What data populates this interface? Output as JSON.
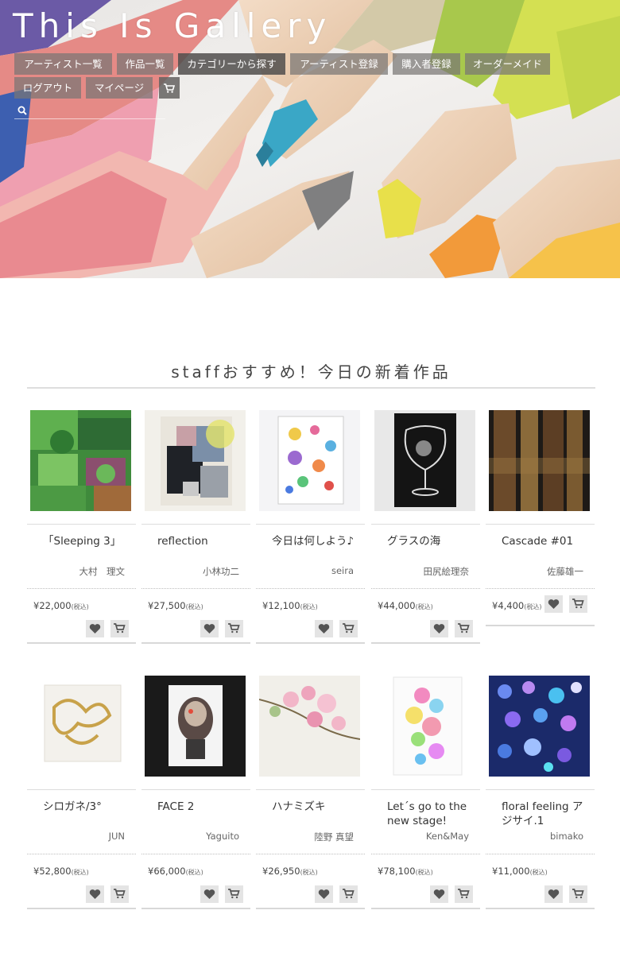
{
  "site": {
    "title": "This Is Gallery"
  },
  "nav": {
    "items": [
      "アーティスト一覧",
      "作品一覧",
      "カテゴリーから探す",
      "アーティスト登録",
      "購入者登録",
      "オーダーメイド",
      "ログアウト",
      "マイページ"
    ],
    "cart_icon": "cart-icon",
    "search_icon": "search-icon",
    "search_placeholder": ""
  },
  "section": {
    "title": "staffおすすめ！今日の新着作品"
  },
  "price_suffix": "(税込)",
  "works": [
    {
      "title": "「Sleeping 3」",
      "artist": "大村　理文",
      "price": "¥22,000"
    },
    {
      "title": "reflection",
      "artist": "小林功二",
      "price": "¥27,500"
    },
    {
      "title": "今日は何しよう♪",
      "artist": "seira",
      "price": "¥12,100"
    },
    {
      "title": "グラスの海",
      "artist": "田尻絵理奈",
      "price": "¥44,000"
    },
    {
      "title": "Cascade #01",
      "artist": "佐藤雄一",
      "price": "¥4,400"
    },
    {
      "title": "シロガネ/3°",
      "artist": "JUN",
      "price": "¥52,800"
    },
    {
      "title": "FACE 2",
      "artist": "Yaguito",
      "price": "¥66,000"
    },
    {
      "title": "ハナミズキ",
      "artist": "陸野 真望",
      "price": "¥26,950"
    },
    {
      "title": "Let´s go to the new stage!",
      "artist": "Ken&May",
      "price": "¥78,100"
    },
    {
      "title": "floral feeling アジサイ.1",
      "artist": "bimako",
      "price": "¥11,000"
    }
  ],
  "card_actions": {
    "favorite_icon": "heart-icon",
    "cart_icon": "cart-icon"
  },
  "colors": {
    "nav_bg": "#787674",
    "button_bg": "#e4e4e4",
    "rule": "#dcdcdc",
    "text": "#333333"
  }
}
